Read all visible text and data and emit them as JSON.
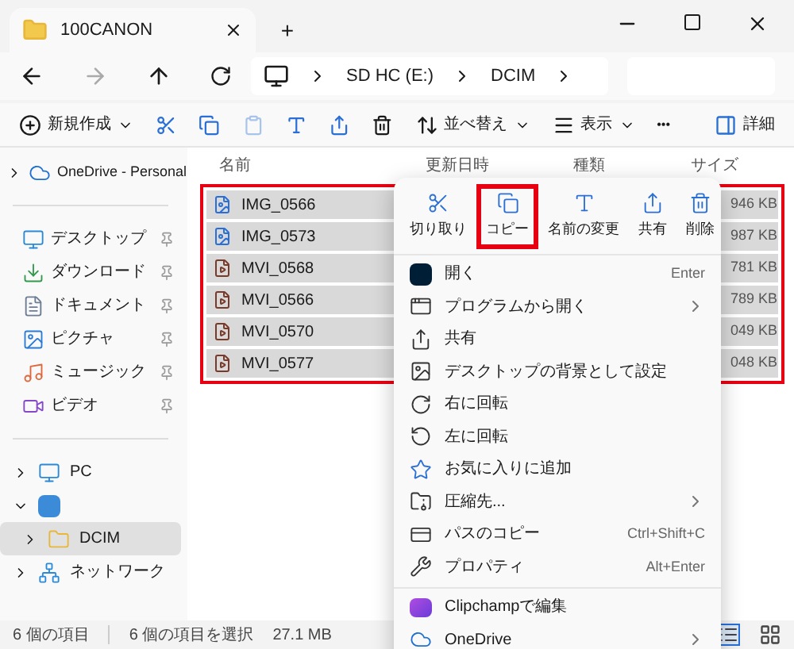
{
  "tab": {
    "title": "100CANON",
    "add": "+"
  },
  "address": {
    "crumbs": [
      "SD HC (E:)",
      "DCIM"
    ]
  },
  "toolbar": {
    "new": "新規作成",
    "sort": "並べ替え",
    "view": "表示",
    "more": "•••",
    "details": "詳細"
  },
  "sidebar": {
    "top": [
      {
        "label": "OneDrive - Personal"
      }
    ],
    "quick": [
      {
        "label": "デスクトップ"
      },
      {
        "label": "ダウンロード"
      },
      {
        "label": "ドキュメント"
      },
      {
        "label": "ピクチャ"
      },
      {
        "label": "ミュージック"
      },
      {
        "label": "ビデオ"
      }
    ],
    "drives": [
      {
        "label": "PC",
        "expanded": false,
        "selected": false
      },
      {
        "expanded": true,
        "selected": false,
        "children": [
          {
            "label": "DCIM",
            "expanded": false,
            "selected": true
          }
        ]
      },
      {
        "label": "ネットワーク",
        "expanded": false,
        "selected": false
      }
    ]
  },
  "table": {
    "columns": [
      "名前",
      "更新日時",
      "種類",
      "サイズ"
    ],
    "rows": [
      {
        "name": "IMG_0566",
        "kind": "image",
        "size": "946 KB",
        "selected": true
      },
      {
        "name": "IMG_0573",
        "kind": "image",
        "size": "987 KB",
        "selected": true
      },
      {
        "name": "MVI_0568",
        "kind": "video",
        "size": "781 KB",
        "selected": true
      },
      {
        "name": "MVI_0566",
        "kind": "video",
        "size": "789 KB",
        "selected": true
      },
      {
        "name": "MVI_0570",
        "kind": "video",
        "size": "049 KB",
        "selected": true
      },
      {
        "name": "MVI_0577",
        "kind": "video",
        "size": "048 KB",
        "selected": true
      }
    ]
  },
  "context_menu": {
    "actions": [
      {
        "label": "切り取り",
        "highlighted": false
      },
      {
        "label": "コピー",
        "highlighted": true
      },
      {
        "label": "名前の変更",
        "highlighted": false
      },
      {
        "label": "共有",
        "highlighted": false
      },
      {
        "label": "削除",
        "highlighted": false
      }
    ],
    "items": [
      {
        "label": "開く",
        "shortcut": "Enter",
        "submenu": false
      },
      {
        "label": "プログラムから開く",
        "submenu": true
      },
      {
        "label": "共有",
        "submenu": false
      },
      {
        "label": "デスクトップの背景として設定",
        "submenu": false
      },
      {
        "label": "右に回転",
        "submenu": false
      },
      {
        "label": "左に回転",
        "submenu": false
      },
      {
        "label": "お気に入りに追加",
        "submenu": false
      },
      {
        "label": "圧縮先...",
        "submenu": true
      },
      {
        "label": "パスのコピー",
        "shortcut": "Ctrl+Shift+C",
        "submenu": false
      },
      {
        "label": "プロパティ",
        "shortcut": "Alt+Enter",
        "submenu": false
      }
    ],
    "extra_items": [
      {
        "label": "Clipchampで編集",
        "submenu": false
      },
      {
        "label": "OneDrive",
        "submenu": true
      }
    ]
  },
  "status_bar": {
    "count": "6 個の項目",
    "selection": "6 個の項目を選択",
    "size": "27.1 MB"
  }
}
